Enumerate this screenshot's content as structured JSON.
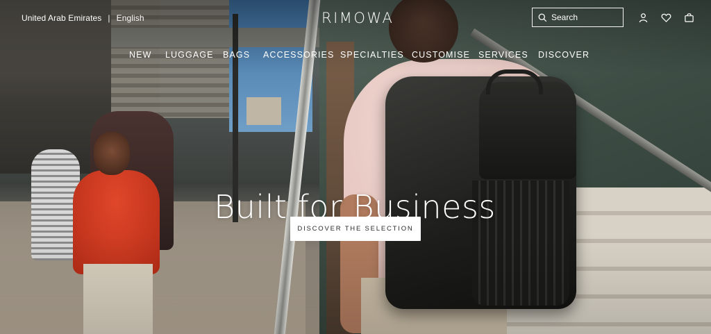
{
  "header": {
    "country": "United Arab Emirates",
    "separator": "|",
    "language": "English",
    "logo": "RIMOWA",
    "search": {
      "placeholder": "Search"
    },
    "icons": [
      "search-icon",
      "user-icon",
      "heart-icon",
      "shopping-bag-icon"
    ]
  },
  "nav": {
    "items": [
      {
        "label": "NEW"
      },
      {
        "label": "LUGGAGE"
      },
      {
        "label": "BAGS"
      },
      {
        "label": "ACCESSORIES"
      },
      {
        "label": "SPECIALTIES"
      },
      {
        "label": "CUSTOMISE"
      },
      {
        "label": "SERVICES"
      },
      {
        "label": "DISCOVER"
      }
    ]
  },
  "hero": {
    "title": "Built for Business",
    "cta": "DISCOVER THE SELECTION"
  },
  "colors": {
    "text_on_hero": "#ffffff",
    "cta_background": "#ffffff",
    "cta_text": "#2a2a2a"
  }
}
